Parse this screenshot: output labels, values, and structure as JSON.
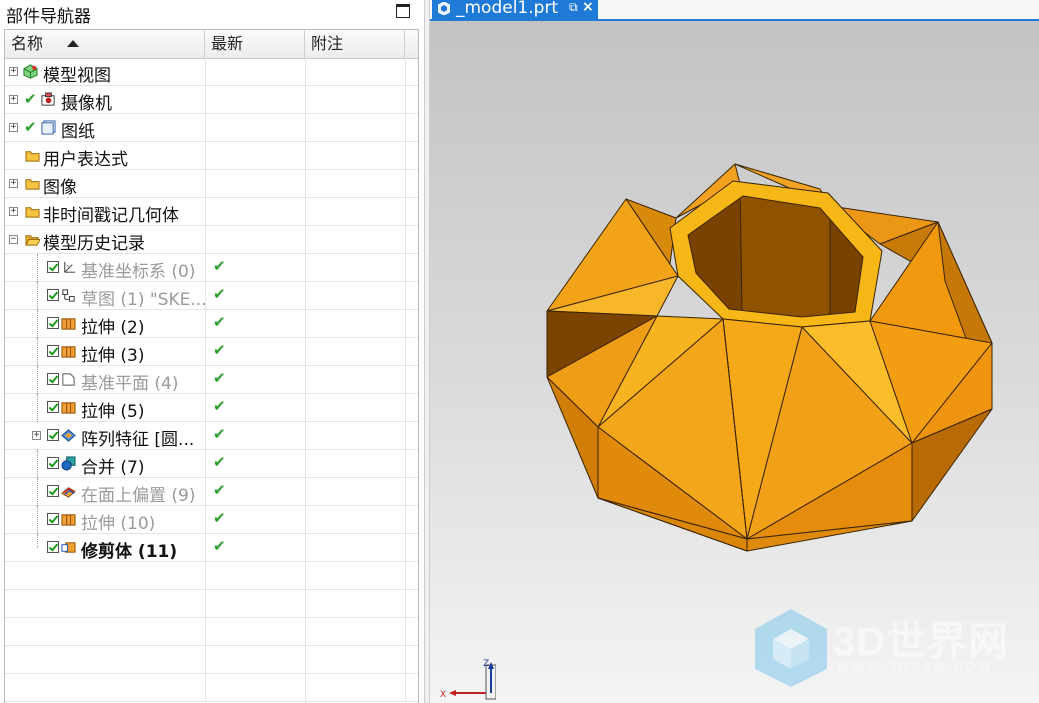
{
  "navigator": {
    "title": "部件导航器",
    "columns": {
      "name": "名称",
      "latest": "最新",
      "note": "附注"
    },
    "rows": [
      {
        "label": "模型视图",
        "expander": "+",
        "check": false,
        "icon": "model-views-icon",
        "latest": ""
      },
      {
        "label": "摄像机",
        "expander": "+",
        "check": true,
        "icon": "camera-icon",
        "latest": ""
      },
      {
        "label": "图纸",
        "expander": "+",
        "check": true,
        "icon": "drawing-sheet-icon",
        "latest": ""
      },
      {
        "label": "用户表达式",
        "expander": "",
        "check": false,
        "icon": "folder-icon",
        "latest": ""
      },
      {
        "label": "图像",
        "expander": "+",
        "check": false,
        "icon": "folder-icon",
        "latest": ""
      },
      {
        "label": "非时间戳记几何体",
        "expander": "+",
        "check": false,
        "icon": "folder-icon",
        "latest": ""
      },
      {
        "label": "模型历史记录",
        "expander": "−",
        "check": false,
        "icon": "folder-open-icon",
        "latest": ""
      },
      {
        "label": "基准坐标系 (0)",
        "latest": "✔",
        "icon": "datum-csys-icon",
        "dim": true
      },
      {
        "label": "草图 (1) \"SKE...",
        "latest": "✔",
        "icon": "sketch-icon",
        "dim": true
      },
      {
        "label": "拉伸 (2)",
        "latest": "✔",
        "icon": "extrude-icon",
        "dim": false
      },
      {
        "label": "拉伸 (3)",
        "latest": "✔",
        "icon": "extrude-icon",
        "dim": false
      },
      {
        "label": "基准平面 (4)",
        "latest": "✔",
        "icon": "datum-plane-icon",
        "dim": true
      },
      {
        "label": "拉伸 (5)",
        "latest": "✔",
        "icon": "extrude-icon",
        "dim": false
      },
      {
        "label": "阵列特征 [圆...",
        "latest": "✔",
        "icon": "pattern-feature-icon",
        "dim": false,
        "expander": "+"
      },
      {
        "label": "合并 (7)",
        "latest": "✔",
        "icon": "unite-icon",
        "dim": false
      },
      {
        "label": "在面上偏置 (9)",
        "latest": "✔",
        "icon": "offset-in-face-icon",
        "dim": true
      },
      {
        "label": "拉伸 (10)",
        "latest": "✔",
        "icon": "extrude-icon",
        "dim": true
      },
      {
        "label": "修剪体 (11)",
        "latest": "✔",
        "icon": "trim-body-icon",
        "dim": false,
        "bold": true
      }
    ]
  },
  "tab": {
    "label": "_model1.prt",
    "pin": "⧉",
    "close": "×"
  },
  "triad": {
    "z": "Z",
    "x": "X"
  },
  "watermark": {
    "title": "3D世界网",
    "url": "WWW.3DSJW.COM"
  },
  "colors": {
    "accent": "#1f79d6",
    "model_orange": "#f0a010",
    "check_green": "#2ca02c"
  }
}
